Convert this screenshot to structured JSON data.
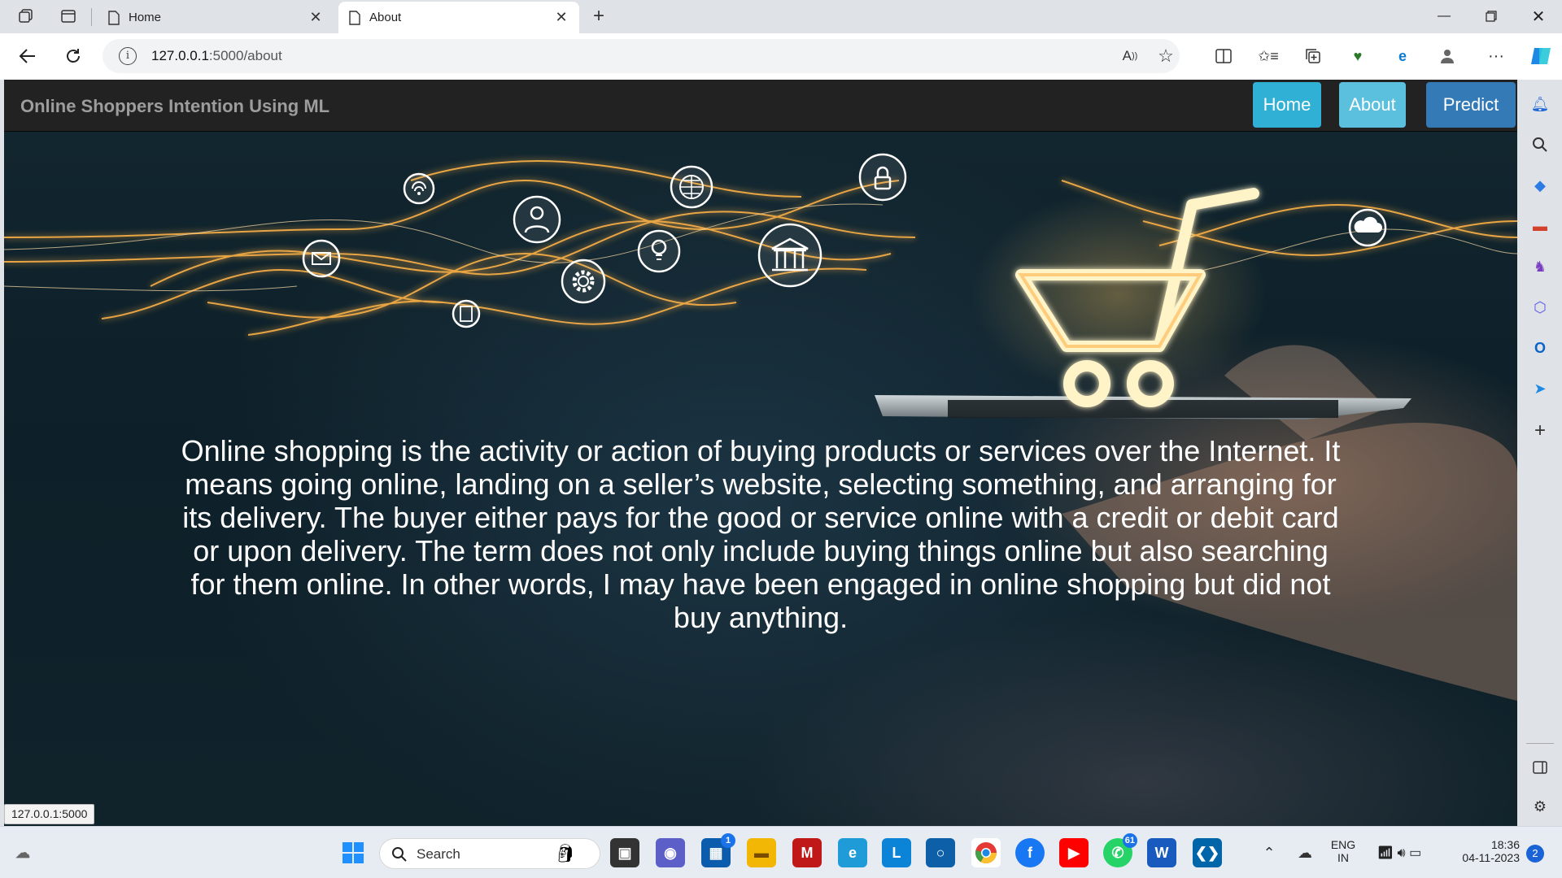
{
  "browser": {
    "tabs": [
      {
        "title": "Home",
        "active": false
      },
      {
        "title": "About",
        "active": true
      }
    ],
    "url_host": "127.0.0.1",
    "url_path": ":5000/about",
    "status_url": "127.0.0.1:5000"
  },
  "site": {
    "brand": "Online Shoppers Intention Using ML",
    "nav": [
      {
        "label": "Home",
        "color": "#31b0d5"
      },
      {
        "label": "About",
        "color": "#5bc0de"
      },
      {
        "label": "Predict",
        "color": "#337ab7"
      }
    ],
    "about_text": "Online shopping is the activity or action of buying products or services over the Internet. It means going online, landing on a seller’s website, selecting something, and arranging for its delivery. The buyer either pays for the good or service online with a credit or debit card or upon delivery. The term does not only include buying things online but also searching for them online. In other words, I may have been engaged in online shopping but did not buy anything."
  },
  "taskbar": {
    "search_placeholder": "Search",
    "store_badge": "1",
    "whatsapp_badge": "61",
    "lang_line1": "ENG",
    "lang_line2": "IN",
    "time": "18:36",
    "date": "04-11-2023",
    "notification_count": "2"
  },
  "colors": {
    "navbar": "#222222",
    "brand_text": "#9d9d9d",
    "glow": "#ffb347"
  }
}
